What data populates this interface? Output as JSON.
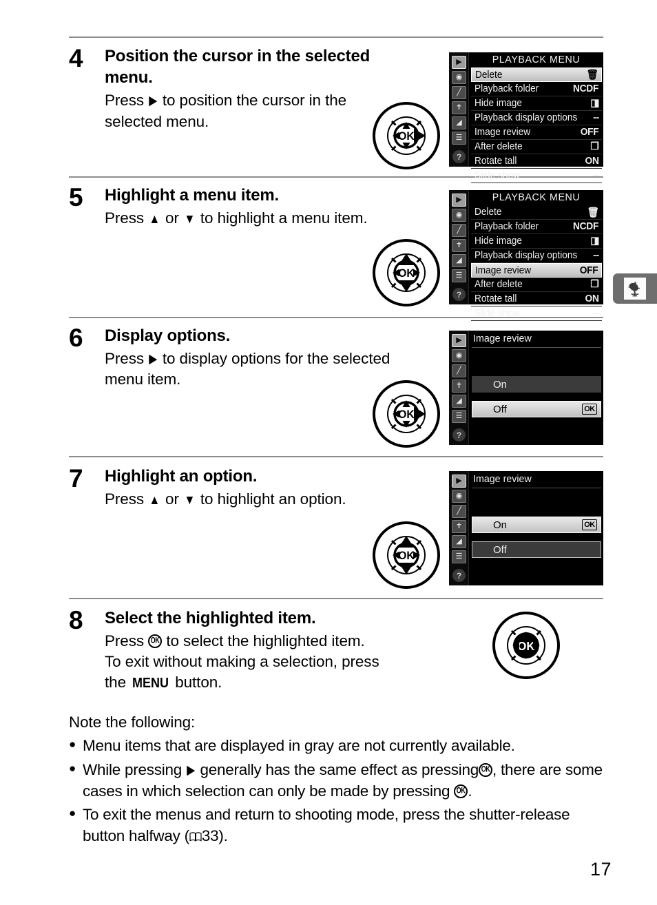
{
  "page": {
    "number": "17"
  },
  "edge_tab": {
    "icon": "rooster-weathervane-icon"
  },
  "steps": [
    {
      "number": "4",
      "title": "Position the cursor in the selected menu.",
      "desc_pre": "Press",
      "desc_glyph": "▶",
      "desc_post": "to position the cursor in the selected menu.",
      "dial": "right"
    },
    {
      "number": "5",
      "title": "Highlight a menu item.",
      "desc_pre": "Press",
      "desc_glyph": "▲",
      "desc_mid": "or",
      "desc_glyph2": "▼",
      "desc_post": "to highlight a menu item.",
      "dial": "updown"
    },
    {
      "number": "6",
      "title": "Display options.",
      "desc_pre": "Press",
      "desc_glyph": "▶",
      "desc_post": "to display options for the selected menu item.",
      "dial": "right"
    },
    {
      "number": "7",
      "title": "Highlight an option.",
      "desc_pre": "Press",
      "desc_glyph": "▲",
      "desc_mid": "or",
      "desc_glyph2": "▼",
      "desc_post": "to highlight an option.",
      "dial": "updown"
    },
    {
      "number": "8",
      "title": "Select the highlighted item.",
      "line1_pre": "Press",
      "line1_post": "to select the highlighted item.",
      "line2": "To exit without making a selection, press",
      "line3_pre": "the",
      "line3_btn": "MENU",
      "line3_post": "button.",
      "dial": "ok"
    }
  ],
  "playback_menu": {
    "title": "PLAYBACK MENU",
    "sidebar_icons": [
      "playback-icon",
      "shooting-camera-icon",
      "custom-settings-pencil-icon",
      "setup-wrench-icon",
      "retouch-icon",
      "recent-settings-icon"
    ],
    "help_icon": "?",
    "rows": [
      {
        "label": "Delete",
        "value": "🗑",
        "value_type": "trash-icon"
      },
      {
        "label": "Playback folder",
        "value": "NCDF",
        "value_type": "text"
      },
      {
        "label": "Hide image",
        "value": "◨",
        "value_type": "hide-image-icon"
      },
      {
        "label": "Playback display options",
        "value": "--",
        "value_type": "text"
      },
      {
        "label": "Image review",
        "value": "OFF",
        "value_type": "text"
      },
      {
        "label": "After delete",
        "value": "❐",
        "value_type": "after-delete-icon"
      },
      {
        "label": "Rotate tall",
        "value": "ON",
        "value_type": "text"
      },
      {
        "label": "Slide show",
        "value": "--",
        "value_type": "text"
      }
    ],
    "step4_highlight": "Delete",
    "step5_highlight": "Image review"
  },
  "image_review_screen": {
    "title": "Image review",
    "options": [
      {
        "label": "On"
      },
      {
        "label": "Off"
      }
    ],
    "ok_badge": "OK",
    "step6_selected": "Off",
    "step7_selected": "On"
  },
  "notes": {
    "heading": "Note the following:",
    "bullets": [
      {
        "kind": "plain",
        "text": "Menu items that are displayed in gray are not currently available."
      },
      {
        "kind": "glyphs",
        "pre": "While pressing",
        "mid": "generally has the same effect as pressing",
        "post": ", there are some cases in which selection can only be made by pressing",
        "tail": "."
      },
      {
        "kind": "ref",
        "pre": "To exit the menus and return to shooting mode, press the shutter-release button halfway (",
        "ref": "33",
        "post": ")."
      }
    ]
  },
  "colors": {
    "rule": "#8c8c8c",
    "lcd_background": "#000000",
    "lcd_highlight": "#dcdcdc",
    "tab_gray": "#6e6e6e"
  }
}
